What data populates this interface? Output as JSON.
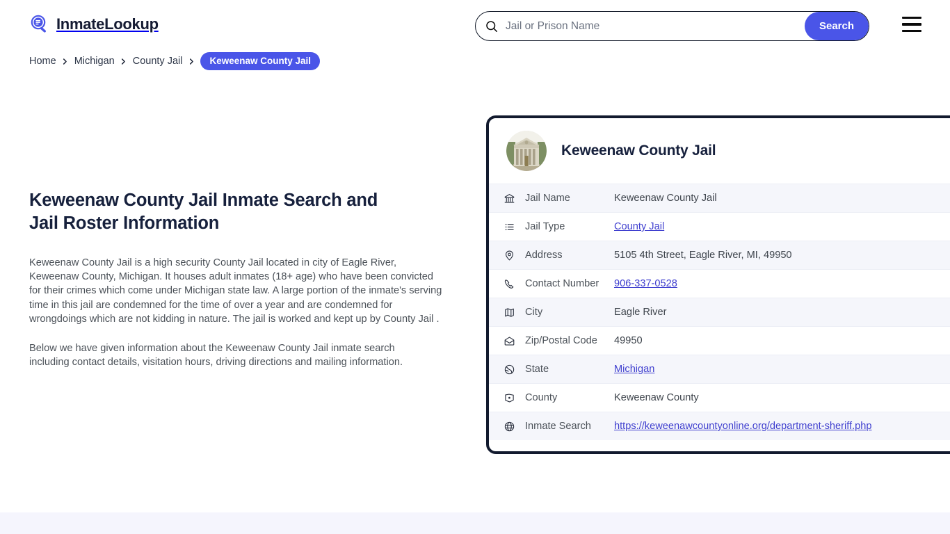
{
  "header": {
    "logo": {
      "icon": "magnifier-list-icon",
      "text": "InmateLookup"
    },
    "search": {
      "icon": "search-icon",
      "placeholder": "Jail or Prison Name",
      "value": "",
      "button_label": "Search"
    },
    "menu_icon": "hamburger-menu-icon"
  },
  "breadcrumb": {
    "items": [
      {
        "label": "Home"
      },
      {
        "label": "Michigan"
      },
      {
        "label": "County Jail"
      }
    ],
    "current": "Keweenaw County Jail",
    "separator": "›"
  },
  "main": {
    "title": "Keweenaw County Jail Inmate Search and Jail Roster Information",
    "paragraph_1": "Keweenaw County Jail is a high security County Jail located in city of Eagle River, Keweenaw County, Michigan. It houses adult inmates (18+ age) who have been convicted for their crimes which come under Michigan state law. A large portion of the inmate's serving time in this jail are condemned for the time of over a year and are condemned for wrongdoings which are not kidding in nature. The jail is worked and kept up by County Jail .",
    "paragraph_2": "Below we have given information about the Keweenaw County Jail inmate search including contact details, visitation hours, driving directions and mailing information."
  },
  "card": {
    "avatar_icon": "courthouse-building-photo",
    "title": "Keweenaw County Jail",
    "rows": [
      {
        "icon": "bank-landmark-icon",
        "label": "Jail Name",
        "value": "Keweenaw County Jail",
        "link": false
      },
      {
        "icon": "list-icon",
        "label": "Jail Type",
        "value": "County Jail",
        "link": true
      },
      {
        "icon": "map-pin-icon",
        "label": "Address",
        "value": "5105 4th Street, Eagle River, MI, 49950",
        "link": false
      },
      {
        "icon": "phone-icon",
        "label": "Contact Number",
        "value": "906-337-0528",
        "link": true
      },
      {
        "icon": "map-icon",
        "label": "City",
        "value": "Eagle River",
        "link": false
      },
      {
        "icon": "envelope-open-icon",
        "label": "Zip/Postal Code",
        "value": "49950",
        "link": false
      },
      {
        "icon": "globe-outline-icon",
        "label": "State",
        "value": "Michigan",
        "link": true
      },
      {
        "icon": "county-marker-icon",
        "label": "County",
        "value": "Keweenaw County",
        "link": false
      },
      {
        "icon": "globe-grid-icon",
        "label": "Inmate Search",
        "value": "https://keweenawcountyonline.org/department-sheriff.php",
        "link": true
      }
    ]
  },
  "colors": {
    "accent": "#4a55e8",
    "card_border": "#121a2e",
    "heading": "#16203c",
    "link": "#3f3fcf",
    "row_alt": "#f5f6fb",
    "footer_band": "#f5f5fd"
  }
}
